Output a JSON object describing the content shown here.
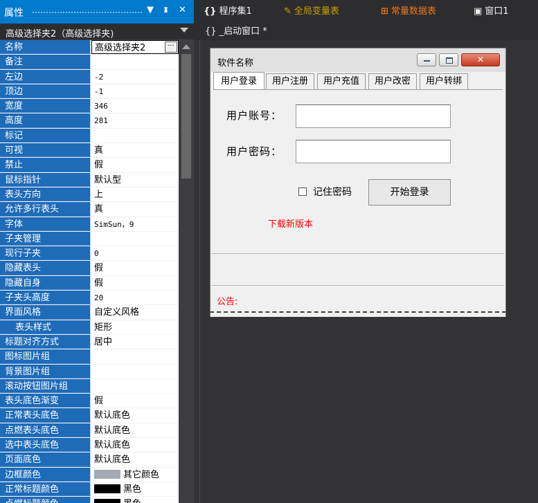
{
  "properties_panel": {
    "title": "属性",
    "dropdown_icon": "▼",
    "pin_icon": "ᵻ",
    "close_icon": "✕",
    "object_selector": "高级选择夹2（高级选择夹)",
    "rows": [
      {
        "name": "名称",
        "value": "高级选择夹2",
        "selected": true
      },
      {
        "name": "备注",
        "value": ""
      },
      {
        "name": "左边",
        "value": "-2",
        "mono": true
      },
      {
        "name": "顶边",
        "value": "-1",
        "mono": true
      },
      {
        "name": "宽度",
        "value": "346",
        "mono": true
      },
      {
        "name": "高度",
        "value": "281",
        "mono": true
      },
      {
        "name": "标记",
        "value": ""
      },
      {
        "name": "可视",
        "value": "真"
      },
      {
        "name": "禁止",
        "value": "假"
      },
      {
        "name": "鼠标指针",
        "value": "默认型"
      },
      {
        "name": "表头方向",
        "value": "上"
      },
      {
        "name": "允许多行表头",
        "value": "真"
      },
      {
        "name": "字体",
        "value": "SimSun，9",
        "mono": true
      },
      {
        "name": "子夹管理",
        "value": ""
      },
      {
        "name": "现行子夹",
        "value": "0",
        "mono": true
      },
      {
        "name": "隐藏表头",
        "value": "假"
      },
      {
        "name": "隐藏自身",
        "value": "假"
      },
      {
        "name": "子夹头高度",
        "value": "20",
        "mono": true
      },
      {
        "name": "界面风格",
        "value": "自定义风格"
      },
      {
        "name": "表头样式",
        "value": "矩形",
        "indent": true
      },
      {
        "name": "标题对齐方式",
        "value": "居中"
      },
      {
        "name": "图标图片组",
        "value": ""
      },
      {
        "name": "背景图片组",
        "value": ""
      },
      {
        "name": "滚动按钮图片组",
        "value": ""
      },
      {
        "name": "表头底色渐变",
        "value": "假"
      },
      {
        "name": "正常表头底色",
        "value": "默认底色"
      },
      {
        "name": "点燃表头底色",
        "value": "默认底色"
      },
      {
        "name": "选中表头底色",
        "value": "默认底色"
      },
      {
        "name": "页面底色",
        "value": "默认底色"
      },
      {
        "name": "边框颜色",
        "value": "其它颜色",
        "swatch": "#a3aab3"
      },
      {
        "name": "正常标题颜色",
        "value": "黑色",
        "swatch": "#000000"
      },
      {
        "name": "点燃标题颜色",
        "value": "黑色",
        "swatch": "#000000"
      }
    ]
  },
  "document_tabs": [
    {
      "icon": "{}",
      "label": "程序集1",
      "color": "#f1f1f1"
    },
    {
      "icon": "✎",
      "label": "全局变量表",
      "color": "#c8a000"
    },
    {
      "icon": "⊞",
      "label": "常量数据表",
      "color": "#e87722"
    },
    {
      "icon": "▣",
      "label": "窗口1",
      "color": "#f1f1f1"
    }
  ],
  "sub_tab": "{} _启动窗口 *",
  "designer_window": {
    "title": "软件名称",
    "close_glyph": "✕",
    "tabs": [
      "用户登录",
      "用户注册",
      "用户充值",
      "用户改密",
      "用户转绑"
    ],
    "account_label": "用户账号：",
    "password_label": "用户密码：",
    "account_value": "",
    "password_value": "",
    "remember_label": "记住密码",
    "remember_checked": false,
    "login_button": "开始登录",
    "download_link": "下载新版本",
    "notice_label": "公告:"
  },
  "colors": {
    "accent": "#007acc",
    "property_name_bg": "#1e6bb8",
    "link_red": "#ff0000"
  }
}
